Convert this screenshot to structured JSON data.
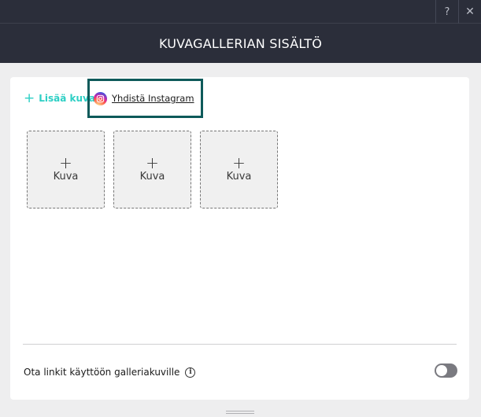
{
  "window": {
    "title": "KUVAGALLERIAN SISÄLTÖ",
    "help_label": "?",
    "close_label": "✕"
  },
  "toolbar": {
    "add_image_label": "Lisää kuva",
    "add_image_icon": "plus-icon",
    "connect_instagram_label": "Yhdistä Instagram",
    "instagram_icon": "instagram-icon"
  },
  "tiles": [
    {
      "label": "Kuva"
    },
    {
      "label": "Kuva"
    },
    {
      "label": "Kuva"
    }
  ],
  "settings": {
    "enable_links_label": "Ota linkit käyttöön galleriakuville",
    "info_label": "i",
    "enable_links_on": false
  },
  "colors": {
    "header_bg": "#2b2e3a",
    "accent": "#2ccfc4",
    "highlight_border": "#0e5a5a",
    "toggle_off": "#7a7a80"
  }
}
